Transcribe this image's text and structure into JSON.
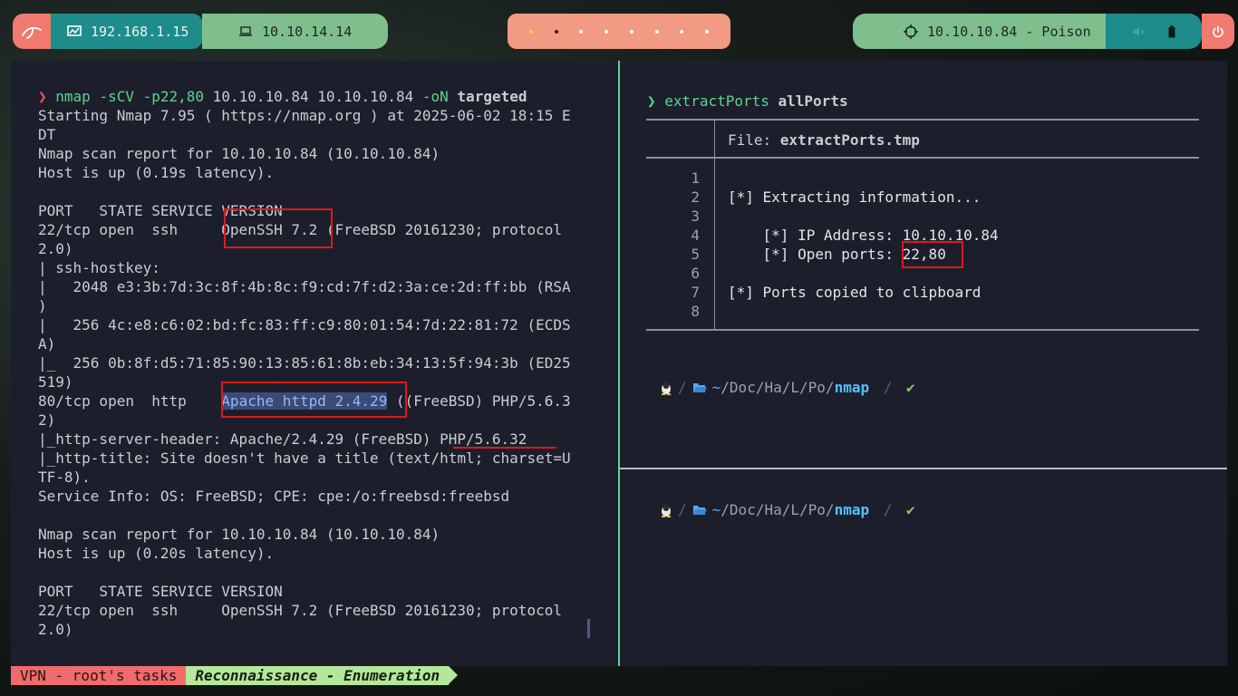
{
  "topbar": {
    "local_ip": "192.168.1.15",
    "vpn_ip": "10.10.14.14",
    "target": "10.10.10.84 - Poison",
    "workspace_count": 8,
    "active_workspace": 2
  },
  "left_pane": {
    "command": {
      "prompt": "❯",
      "program": "nmap",
      "flags": "-sCV -p22,80",
      "args": " 10.10.10.84 10.10.10.84 ",
      "out_flag": "-oN",
      "out_file": "targeted"
    },
    "lines": [
      "Starting Nmap 7.95 ( https://nmap.org ) at 2025-06-02 18:15 E",
      "DT",
      "Nmap scan report for 10.10.10.84 (10.10.10.84)",
      "Host is up (0.19s latency).",
      "",
      "PORT   STATE SERVICE VERSION",
      "22/tcp open  ssh     OpenSSH 7.2 (FreeBSD 20161230; protocol",
      "2.0)",
      "| ssh-hostkey:",
      "|   2048 e3:3b:7d:3c:8f:4b:8c:f9:cd:7f:d2:3a:ce:2d:ff:bb (RSA",
      ")",
      "|   256 4c:e8:c6:02:bd:fc:83:ff:c9:80:01:54:7d:22:81:72 (ECDS",
      "A)",
      "|_  256 0b:8f:d5:71:85:90:13:85:61:8b:eb:34:13:5f:94:3b (ED25",
      "519)",
      "80/tcp open  http    ",
      "2)",
      "|_http-server-header: Apache/2.4.29 (FreeBSD) PHP/5.6.32",
      "|_http-title: Site doesn't have a title (text/html; charset=U",
      "TF-8).",
      "Service Info: OS: FreeBSD; CPE: cpe:/o:freebsd:freebsd",
      "",
      "Nmap scan report for 10.10.10.84 (10.10.10.84)",
      "Host is up (0.20s latency).",
      "",
      "PORT   STATE SERVICE VERSION",
      "22/tcp open  ssh     OpenSSH 7.2 (FreeBSD 20161230; protocol",
      "2.0)"
    ],
    "http_selected": "Apache httpd 2.4.29",
    "http_rest": " ((FreeBSD) PHP/5.6.3"
  },
  "right_top": {
    "prompt_arrow": "❯",
    "command": "extractPorts",
    "arg": "allPorts",
    "file_label": "File: ",
    "file_name": "extractPorts.tmp",
    "line_numbers": [
      "1",
      "2",
      "3",
      "4",
      "5",
      "6",
      "7",
      "8"
    ],
    "content": [
      "",
      "[*] Extracting information...",
      "",
      "    [*] IP Address: 10.10.10.84",
      "    [*] Open ports: 22,80",
      "",
      "[*] Ports copied to clipboard",
      ""
    ]
  },
  "prompt_path": {
    "home": "~",
    "segments": [
      "Doc",
      "Ha",
      "L",
      "Po"
    ],
    "current": "nmap",
    "ok": "✔"
  },
  "tmux": {
    "session": "VPN - root's tasks",
    "window": "Reconnaissance - Enumeration"
  },
  "colors": {
    "highlight": "#e01818",
    "prompt_green": "#5fd38d",
    "terminal_bg": "#1c1f2b"
  }
}
